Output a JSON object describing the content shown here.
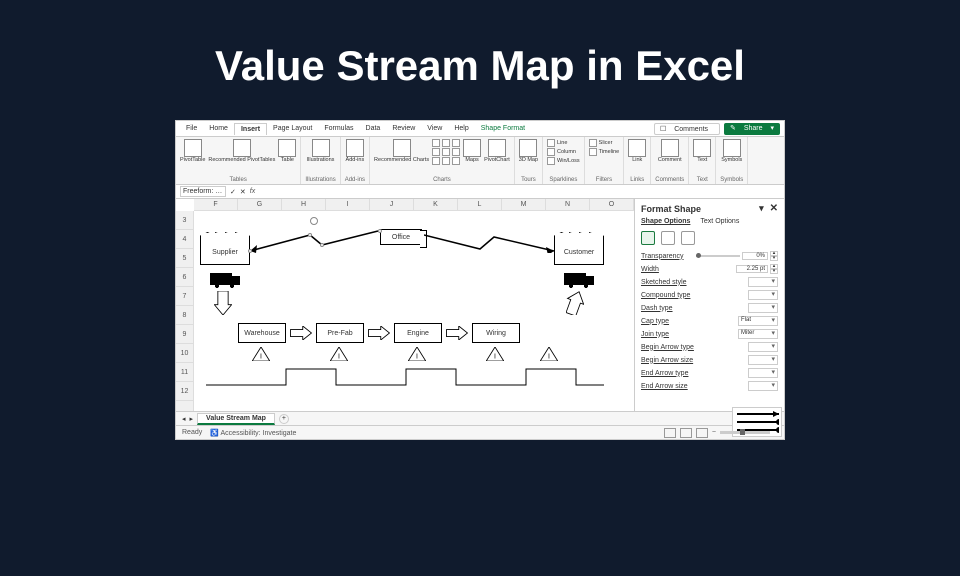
{
  "page_title": "Value Stream Map in Excel",
  "ribbon": {
    "tabs": [
      "File",
      "Home",
      "Insert",
      "Page Layout",
      "Formulas",
      "Data",
      "Review",
      "View",
      "Help",
      "Shape Format"
    ],
    "active": "Insert",
    "comments": "Comments",
    "share": "Share",
    "groups": {
      "tables": {
        "label": "Tables",
        "items": [
          "PivotTable",
          "Recommended PivotTables",
          "Table"
        ]
      },
      "illustrations": {
        "label": "Illustrations",
        "btn": "Illustrations"
      },
      "addins": {
        "label": "Add-ins",
        "btn": "Add-ins"
      },
      "charts": {
        "label": "Charts",
        "rec": "Recommended Charts",
        "maps": "Maps",
        "pc": "PivotChart"
      },
      "tours": {
        "label": "Tours",
        "btn": "3D Map"
      },
      "sparklines": {
        "label": "Sparklines",
        "items": [
          "Line",
          "Column",
          "Win/Loss"
        ]
      },
      "filters": {
        "label": "Filters",
        "items": [
          "Slicer",
          "Timeline"
        ]
      },
      "links": {
        "label": "Links",
        "btn": "Link"
      },
      "comments": {
        "label": "Comments",
        "btn": "Comment"
      },
      "text": {
        "label": "Text",
        "btn": "Text"
      },
      "symbols": {
        "label": "Symbols",
        "btn": "Symbols"
      }
    }
  },
  "formula": {
    "name": "Freeform: …",
    "fx": "fx"
  },
  "cols": [
    "F",
    "G",
    "H",
    "I",
    "J",
    "K",
    "L",
    "M",
    "N",
    "O"
  ],
  "rows": [
    "3",
    "4",
    "5",
    "6",
    "7",
    "8",
    "9",
    "10",
    "11",
    "12"
  ],
  "diagram": {
    "supplier": "Supplier",
    "customer": "Customer",
    "office": "Office",
    "processes": [
      "Warehouse",
      "Pre-Fab",
      "Engine",
      "Wiring"
    ],
    "triangle": "I"
  },
  "pane": {
    "title": "Format Shape",
    "tabs": [
      "Shape Options",
      "Text Options"
    ],
    "rows": {
      "transparency": {
        "label": "Transparency",
        "value": "0%"
      },
      "width": {
        "label": "Width",
        "value": "2.25 pt"
      },
      "sketched": {
        "label": "Sketched style"
      },
      "compound": {
        "label": "Compound type"
      },
      "dash": {
        "label": "Dash type"
      },
      "cap": {
        "label": "Cap type",
        "value": "Flat"
      },
      "join": {
        "label": "Join type",
        "value": "Miter"
      },
      "beginArrow": {
        "label": "Begin Arrow type"
      },
      "beginSize": {
        "label": "Begin Arrow size"
      },
      "endArrow": {
        "label": "End Arrow type"
      },
      "endSize": {
        "label": "End Arrow size"
      }
    }
  },
  "tabs": {
    "sheet": "Value Stream Map"
  },
  "status": {
    "ready": "Ready",
    "access": "Accessibility: Investigate"
  }
}
